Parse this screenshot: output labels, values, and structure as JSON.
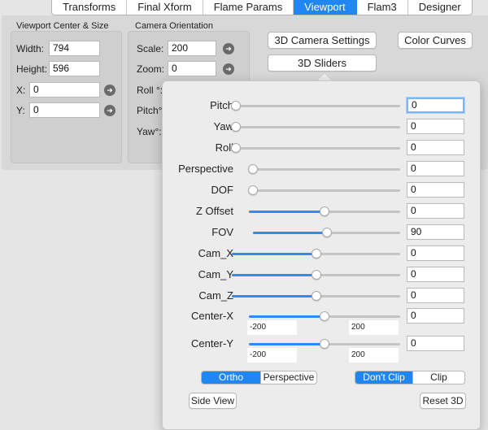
{
  "tabs": [
    {
      "label": "Transforms",
      "active": false
    },
    {
      "label": "Final Xform",
      "active": false
    },
    {
      "label": "Flame Params",
      "active": false
    },
    {
      "label": "Viewport",
      "active": true
    },
    {
      "label": "Flam3",
      "active": false
    },
    {
      "label": "Designer",
      "active": false
    }
  ],
  "viewport_group": {
    "title": "Viewport Center & Size",
    "width_label": "Width:",
    "width_value": "794",
    "height_label": "Height:",
    "height_value": "596",
    "x_label": "X:",
    "x_value": "0",
    "y_label": "Y:",
    "y_value": "0"
  },
  "camera_group": {
    "title": "Camera Orientation",
    "scale_label": "Scale:",
    "scale_value": "200",
    "zoom_label": "Zoom:",
    "zoom_value": "0",
    "roll_label": "Roll °:",
    "pitch_label": "Pitch°",
    "yaw_label": "Yaw°:"
  },
  "buttons": {
    "camera_settings": "3D Camera Settings",
    "color_curves": "Color Curves",
    "sliders": "3D Sliders"
  },
  "sliders": [
    {
      "label": "Pitch",
      "value": "0",
      "position": 0.0
    },
    {
      "label": "Yaw",
      "value": "0",
      "position": 0.0
    },
    {
      "label": "Roll",
      "value": "0",
      "position": 0.0
    },
    {
      "label": "Perspective",
      "value": "0",
      "position": 0.0
    },
    {
      "label": "DOF",
      "value": "0",
      "position": 0.0
    },
    {
      "label": "Z Offset",
      "value": "0",
      "position": 0.5
    },
    {
      "label": "FOV",
      "value": "90",
      "position": 0.5
    },
    {
      "label": "Cam_X",
      "value": "0",
      "position": 0.5
    },
    {
      "label": "Cam_Y",
      "value": "0",
      "position": 0.5
    },
    {
      "label": "Cam_Z",
      "value": "0",
      "position": 0.5
    },
    {
      "label": "Center-X",
      "value": "0",
      "position": 0.5,
      "min": "-200",
      "max": "200"
    },
    {
      "label": "Center-Y",
      "value": "0",
      "position": 0.5,
      "min": "-200",
      "max": "200"
    }
  ],
  "projection": {
    "options": [
      "Ortho",
      "Perspective"
    ],
    "selected": "Ortho"
  },
  "clip": {
    "options": [
      "Don't Clip",
      "Clip"
    ],
    "selected": "Don't Clip"
  },
  "footer": {
    "side_view": "Side View",
    "reset": "Reset 3D"
  },
  "colors": {
    "accent": "#1f86f2",
    "slider_fill": "#2f8bf5"
  },
  "icons": {
    "go_button": "arrow-right-circle-icon"
  }
}
